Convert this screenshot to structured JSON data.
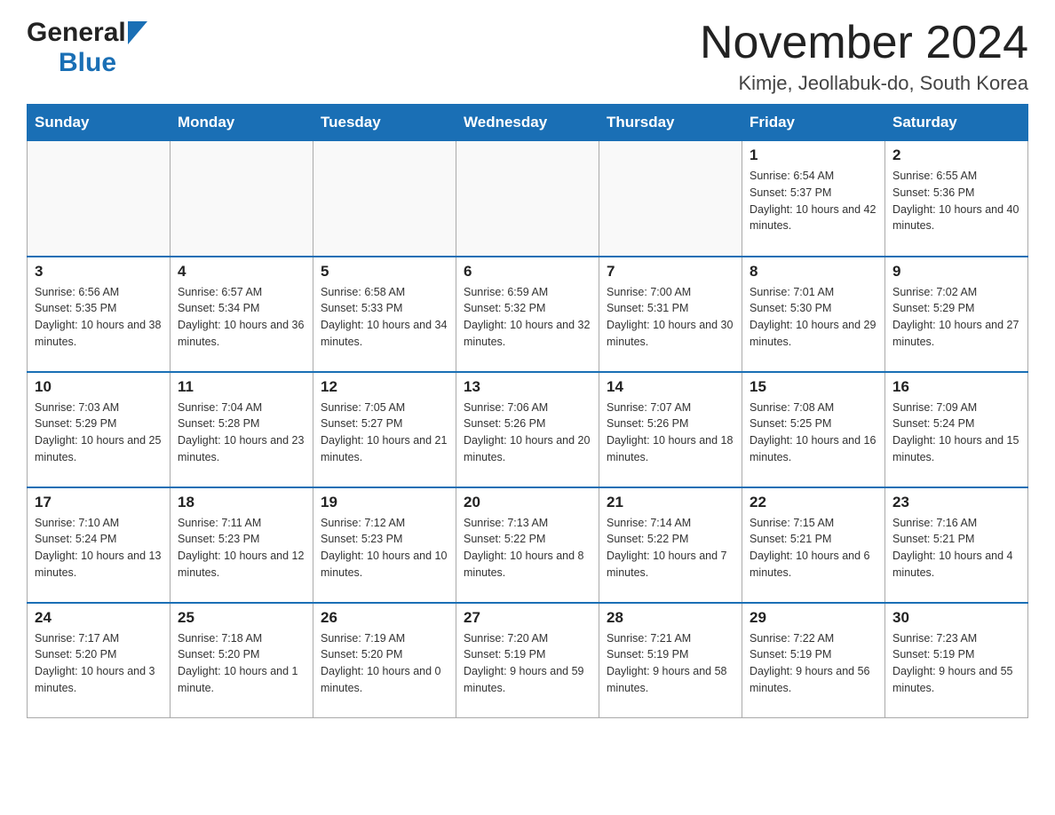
{
  "header": {
    "logo_general": "General",
    "logo_blue": "Blue",
    "month_title": "November 2024",
    "location": "Kimje, Jeollabuk-do, South Korea"
  },
  "days_of_week": [
    "Sunday",
    "Monday",
    "Tuesday",
    "Wednesday",
    "Thursday",
    "Friday",
    "Saturday"
  ],
  "weeks": [
    [
      {
        "day": "",
        "info": ""
      },
      {
        "day": "",
        "info": ""
      },
      {
        "day": "",
        "info": ""
      },
      {
        "day": "",
        "info": ""
      },
      {
        "day": "",
        "info": ""
      },
      {
        "day": "1",
        "info": "Sunrise: 6:54 AM\nSunset: 5:37 PM\nDaylight: 10 hours and 42 minutes."
      },
      {
        "day": "2",
        "info": "Sunrise: 6:55 AM\nSunset: 5:36 PM\nDaylight: 10 hours and 40 minutes."
      }
    ],
    [
      {
        "day": "3",
        "info": "Sunrise: 6:56 AM\nSunset: 5:35 PM\nDaylight: 10 hours and 38 minutes."
      },
      {
        "day": "4",
        "info": "Sunrise: 6:57 AM\nSunset: 5:34 PM\nDaylight: 10 hours and 36 minutes."
      },
      {
        "day": "5",
        "info": "Sunrise: 6:58 AM\nSunset: 5:33 PM\nDaylight: 10 hours and 34 minutes."
      },
      {
        "day": "6",
        "info": "Sunrise: 6:59 AM\nSunset: 5:32 PM\nDaylight: 10 hours and 32 minutes."
      },
      {
        "day": "7",
        "info": "Sunrise: 7:00 AM\nSunset: 5:31 PM\nDaylight: 10 hours and 30 minutes."
      },
      {
        "day": "8",
        "info": "Sunrise: 7:01 AM\nSunset: 5:30 PM\nDaylight: 10 hours and 29 minutes."
      },
      {
        "day": "9",
        "info": "Sunrise: 7:02 AM\nSunset: 5:29 PM\nDaylight: 10 hours and 27 minutes."
      }
    ],
    [
      {
        "day": "10",
        "info": "Sunrise: 7:03 AM\nSunset: 5:29 PM\nDaylight: 10 hours and 25 minutes."
      },
      {
        "day": "11",
        "info": "Sunrise: 7:04 AM\nSunset: 5:28 PM\nDaylight: 10 hours and 23 minutes."
      },
      {
        "day": "12",
        "info": "Sunrise: 7:05 AM\nSunset: 5:27 PM\nDaylight: 10 hours and 21 minutes."
      },
      {
        "day": "13",
        "info": "Sunrise: 7:06 AM\nSunset: 5:26 PM\nDaylight: 10 hours and 20 minutes."
      },
      {
        "day": "14",
        "info": "Sunrise: 7:07 AM\nSunset: 5:26 PM\nDaylight: 10 hours and 18 minutes."
      },
      {
        "day": "15",
        "info": "Sunrise: 7:08 AM\nSunset: 5:25 PM\nDaylight: 10 hours and 16 minutes."
      },
      {
        "day": "16",
        "info": "Sunrise: 7:09 AM\nSunset: 5:24 PM\nDaylight: 10 hours and 15 minutes."
      }
    ],
    [
      {
        "day": "17",
        "info": "Sunrise: 7:10 AM\nSunset: 5:24 PM\nDaylight: 10 hours and 13 minutes."
      },
      {
        "day": "18",
        "info": "Sunrise: 7:11 AM\nSunset: 5:23 PM\nDaylight: 10 hours and 12 minutes."
      },
      {
        "day": "19",
        "info": "Sunrise: 7:12 AM\nSunset: 5:23 PM\nDaylight: 10 hours and 10 minutes."
      },
      {
        "day": "20",
        "info": "Sunrise: 7:13 AM\nSunset: 5:22 PM\nDaylight: 10 hours and 8 minutes."
      },
      {
        "day": "21",
        "info": "Sunrise: 7:14 AM\nSunset: 5:22 PM\nDaylight: 10 hours and 7 minutes."
      },
      {
        "day": "22",
        "info": "Sunrise: 7:15 AM\nSunset: 5:21 PM\nDaylight: 10 hours and 6 minutes."
      },
      {
        "day": "23",
        "info": "Sunrise: 7:16 AM\nSunset: 5:21 PM\nDaylight: 10 hours and 4 minutes."
      }
    ],
    [
      {
        "day": "24",
        "info": "Sunrise: 7:17 AM\nSunset: 5:20 PM\nDaylight: 10 hours and 3 minutes."
      },
      {
        "day": "25",
        "info": "Sunrise: 7:18 AM\nSunset: 5:20 PM\nDaylight: 10 hours and 1 minute."
      },
      {
        "day": "26",
        "info": "Sunrise: 7:19 AM\nSunset: 5:20 PM\nDaylight: 10 hours and 0 minutes."
      },
      {
        "day": "27",
        "info": "Sunrise: 7:20 AM\nSunset: 5:19 PM\nDaylight: 9 hours and 59 minutes."
      },
      {
        "day": "28",
        "info": "Sunrise: 7:21 AM\nSunset: 5:19 PM\nDaylight: 9 hours and 58 minutes."
      },
      {
        "day": "29",
        "info": "Sunrise: 7:22 AM\nSunset: 5:19 PM\nDaylight: 9 hours and 56 minutes."
      },
      {
        "day": "30",
        "info": "Sunrise: 7:23 AM\nSunset: 5:19 PM\nDaylight: 9 hours and 55 minutes."
      }
    ]
  ]
}
